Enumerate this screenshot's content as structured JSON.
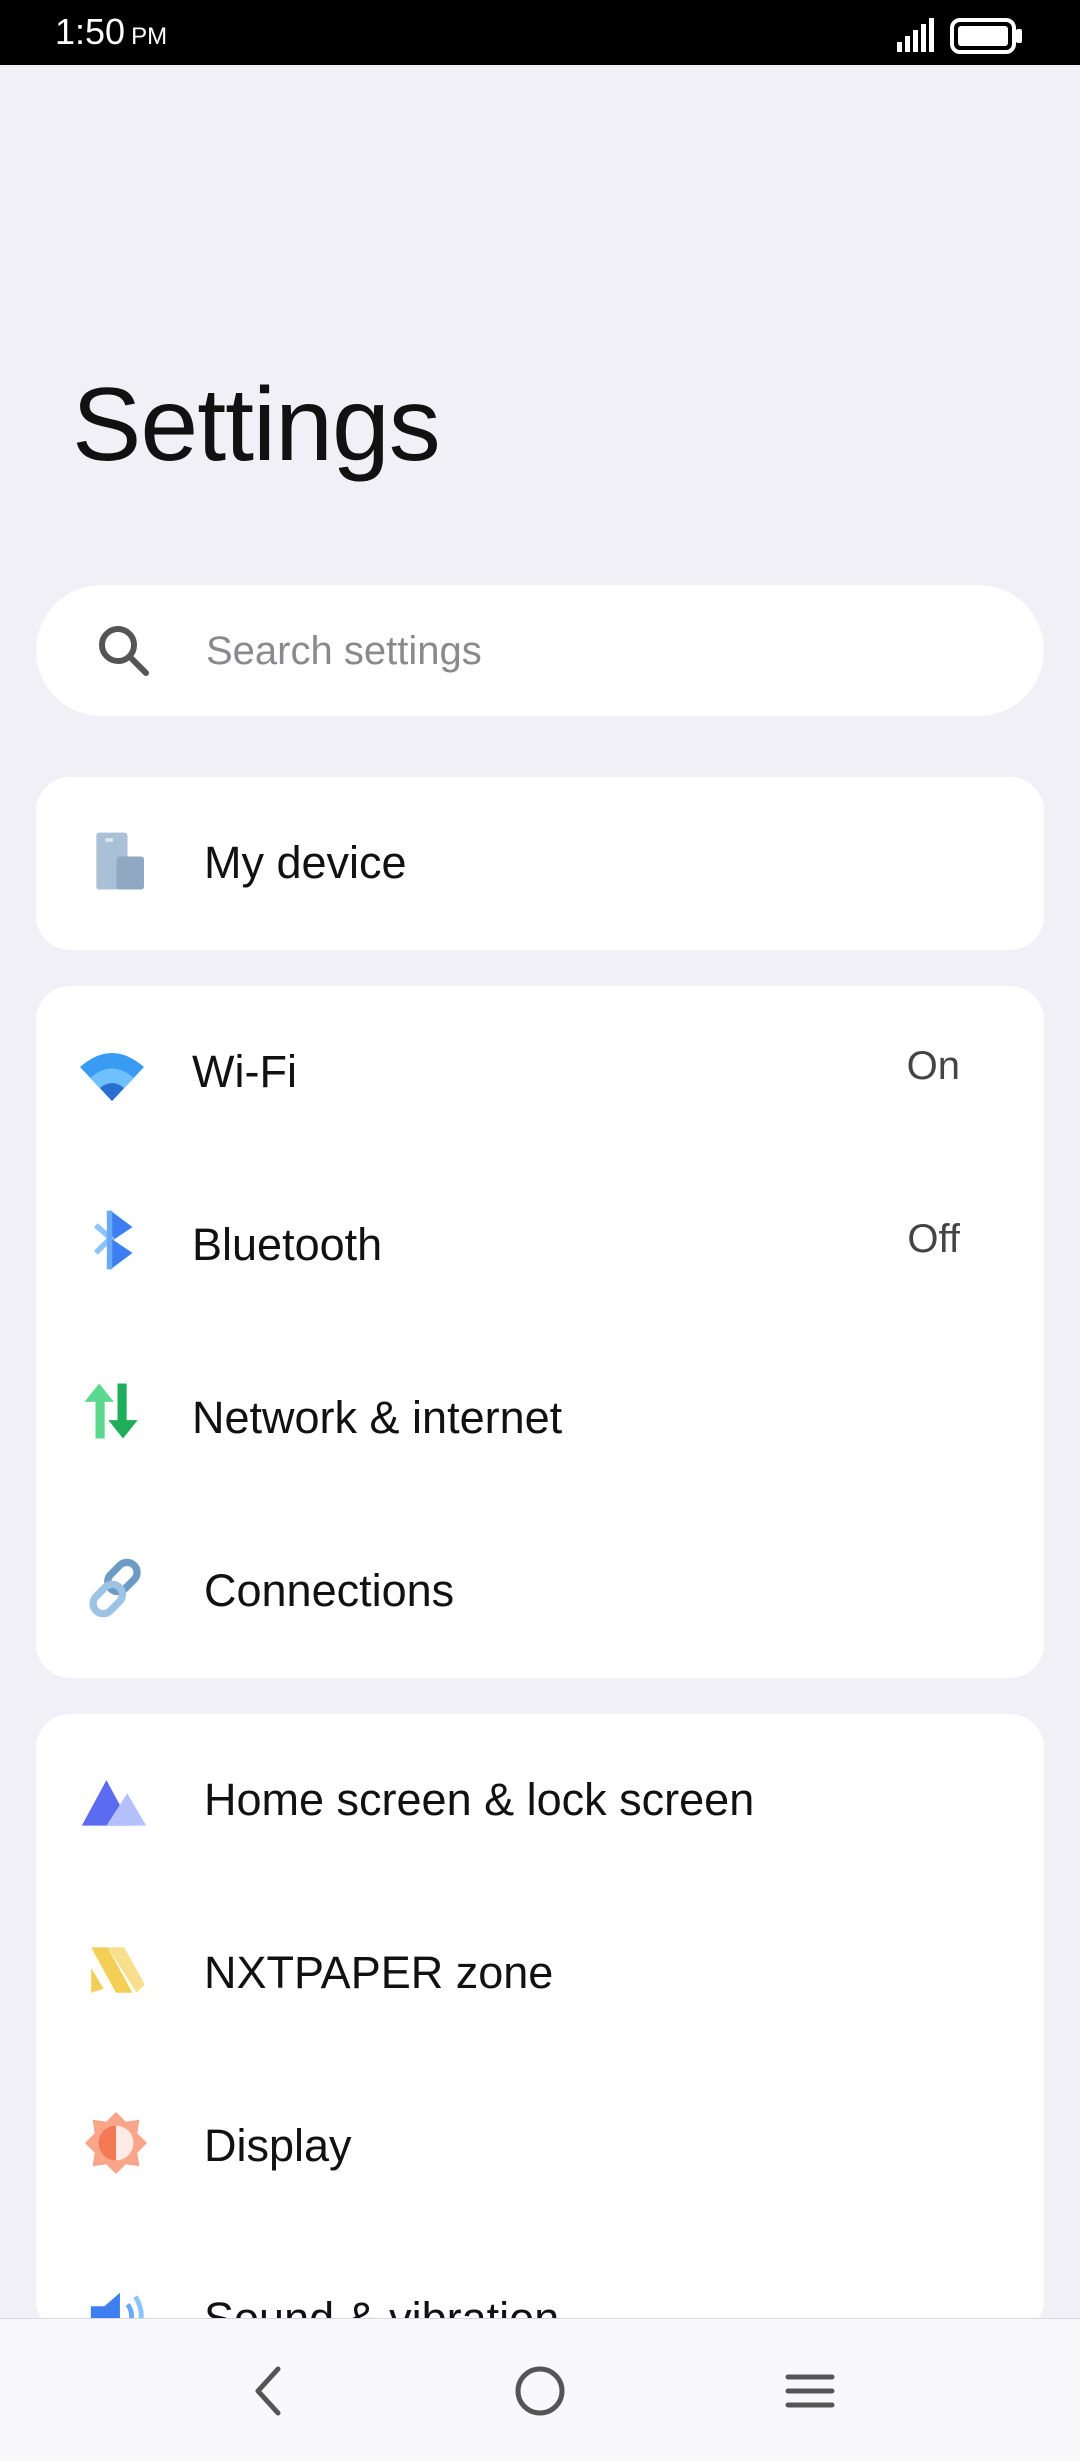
{
  "status_bar": {
    "time": "1:50",
    "ampm": "PM",
    "signal_icon": "cell-signal-icon",
    "battery_icon": "battery-full-icon"
  },
  "page": {
    "title": "Settings"
  },
  "search": {
    "placeholder": "Search settings",
    "value": "",
    "icon": "search-icon"
  },
  "sections": [
    {
      "items": [
        {
          "label": "My device",
          "icon": "phone-device-icon"
        }
      ]
    },
    {
      "items": [
        {
          "label": "Wi-Fi",
          "value": "On",
          "icon": "wifi-icon",
          "accent": "#3a9bf3"
        },
        {
          "label": "Bluetooth",
          "value": "Off",
          "icon": "bluetooth-icon",
          "accent": "#3d7ff0"
        },
        {
          "label": "Network & internet",
          "icon": "network-arrows-icon",
          "accent": "#2ec46d"
        },
        {
          "label": "Connections",
          "icon": "link-icon",
          "accent": "#6e9ac6"
        }
      ]
    },
    {
      "items": [
        {
          "label": "Home screen & lock screen",
          "icon": "mountain-icon",
          "accent": "#5b6cf0"
        },
        {
          "label": "NXTPAPER zone",
          "icon": "nxtpaper-icon",
          "accent": "#f3cf55"
        },
        {
          "label": "Display",
          "icon": "display-sun-icon",
          "accent": "#f37a55"
        },
        {
          "label": "Sound & vibration",
          "icon": "speaker-icon",
          "accent": "#3d7ff0"
        }
      ]
    }
  ],
  "nav": {
    "back_icon": "back-chevron-icon",
    "home_icon": "home-circle-icon",
    "recents_icon": "menu-lines-icon"
  },
  "colors": {
    "background": "#f0f0f6",
    "card": "#ffffff",
    "status_bar": "#000000"
  }
}
